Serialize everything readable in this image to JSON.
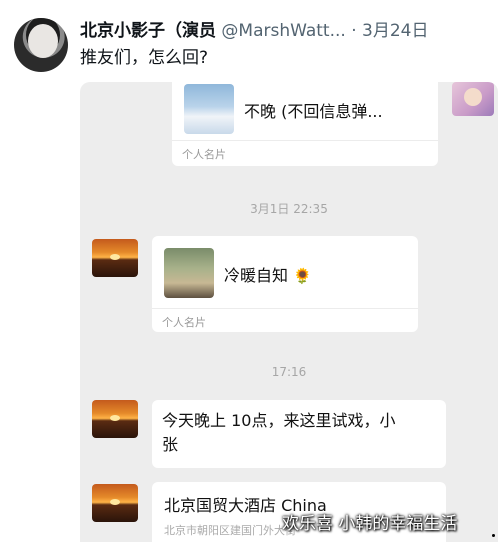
{
  "tweet": {
    "display_name": "北京小影子（演员",
    "handle": "@MarshWatt...",
    "separator": "·",
    "date": "3月24日",
    "text": "推友们，怎么回?"
  },
  "chat": {
    "card1": {
      "title": "不晚 (不回信息弹...",
      "footer": "个人名片"
    },
    "timestamp1": "3月1日 22:35",
    "card2": {
      "title": "冷暖自知",
      "emoji": "🌻",
      "footer": "个人名片"
    },
    "timestamp2": "17:16",
    "message1": {
      "line1": "今天晚上 10点，来这里试戏，小",
      "line2": "张"
    },
    "message2": {
      "title": "北京国贸大酒店 China",
      "subtitle": "北京市朝阳区建国门外大街"
    }
  },
  "watermark": "欢乐喜 小韩的幸福生活",
  "colors": {
    "chat_bg": "#ededed",
    "bubble": "#ffffff",
    "muted": "#999999"
  }
}
